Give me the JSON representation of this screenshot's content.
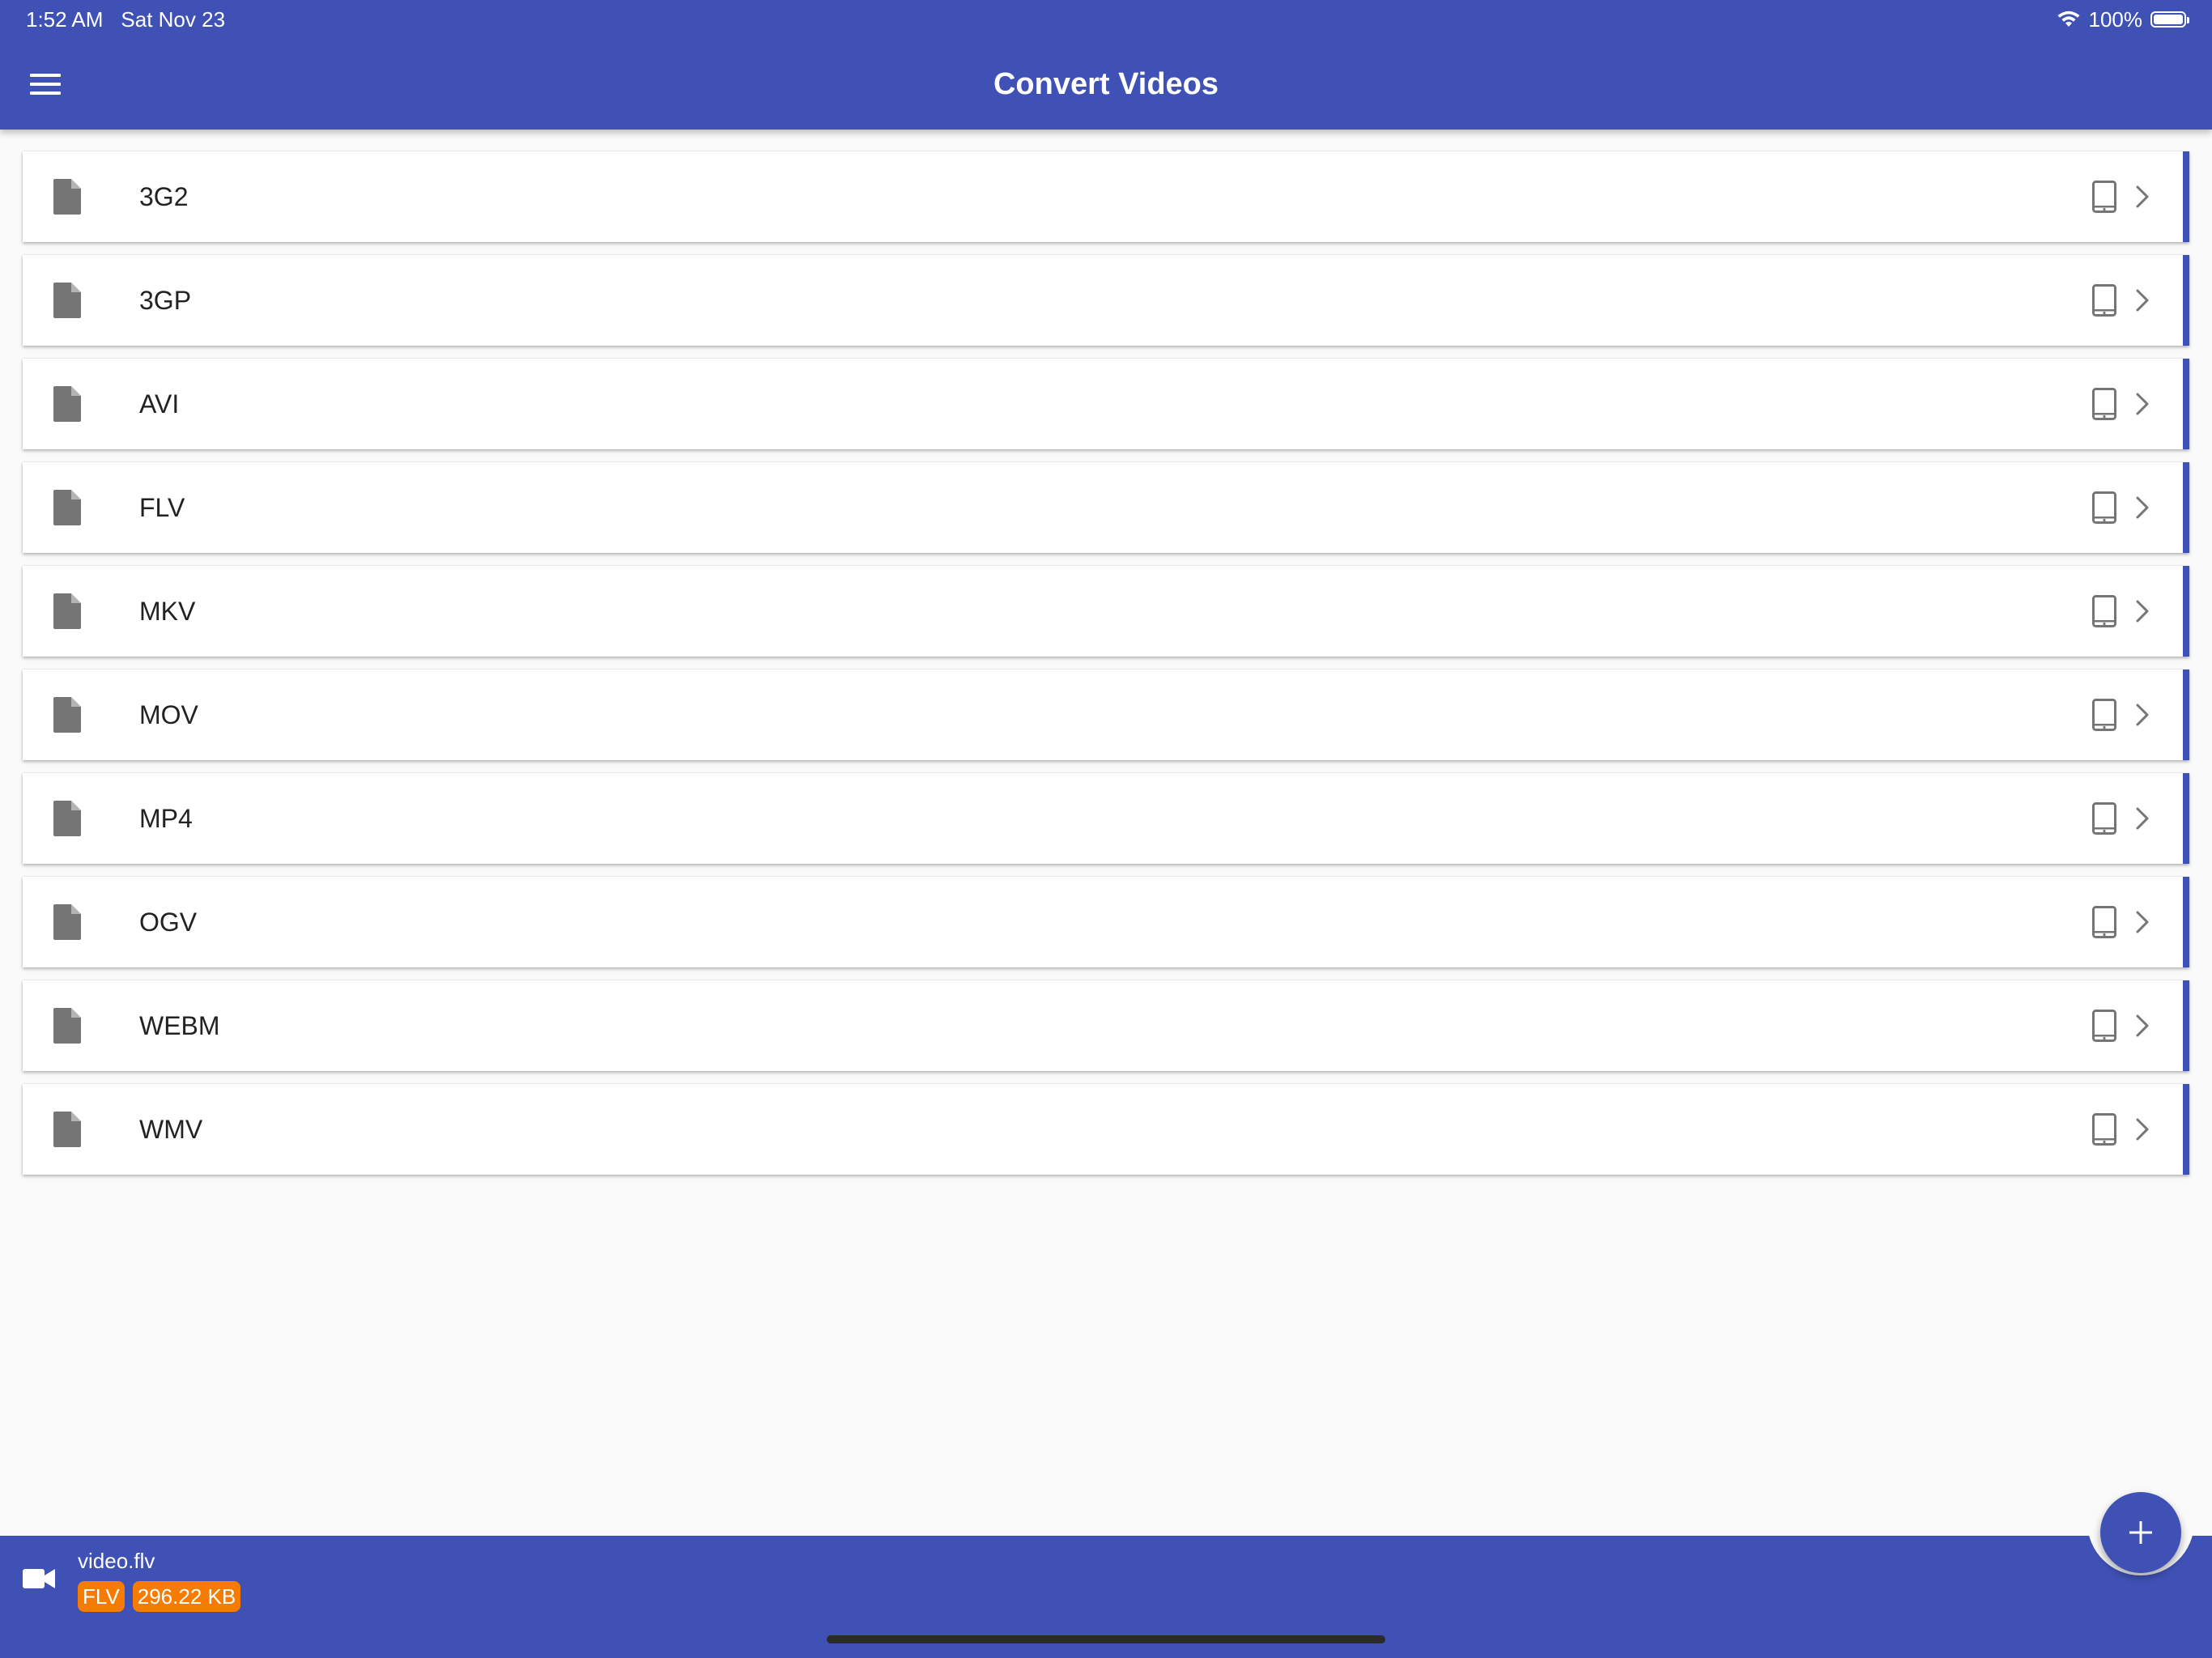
{
  "status_bar": {
    "time": "1:52 AM",
    "date": "Sat Nov 23",
    "battery": "100%"
  },
  "header": {
    "title": "Convert Videos",
    "menu_icon": "hamburger-menu-icon"
  },
  "formats": [
    {
      "label": "3G2"
    },
    {
      "label": "3GP"
    },
    {
      "label": "AVI"
    },
    {
      "label": "FLV"
    },
    {
      "label": "MKV"
    },
    {
      "label": "MOV"
    },
    {
      "label": "MP4"
    },
    {
      "label": "OGV"
    },
    {
      "label": "WEBM"
    },
    {
      "label": "WMV"
    }
  ],
  "list_item_icons": {
    "leading": "file-icon",
    "device": "tablet-icon",
    "trailing": "chevron-right-icon"
  },
  "bottom_bar": {
    "file_name": "video.flv",
    "format_badge": "FLV",
    "size_badge": "296.22 KB",
    "icon": "video-camera-icon"
  },
  "fab": {
    "icon": "plus-icon"
  },
  "colors": {
    "primary": "#3f51b5",
    "badge": "#f57c00",
    "background": "#fafafa",
    "icon_gray": "#757575"
  }
}
